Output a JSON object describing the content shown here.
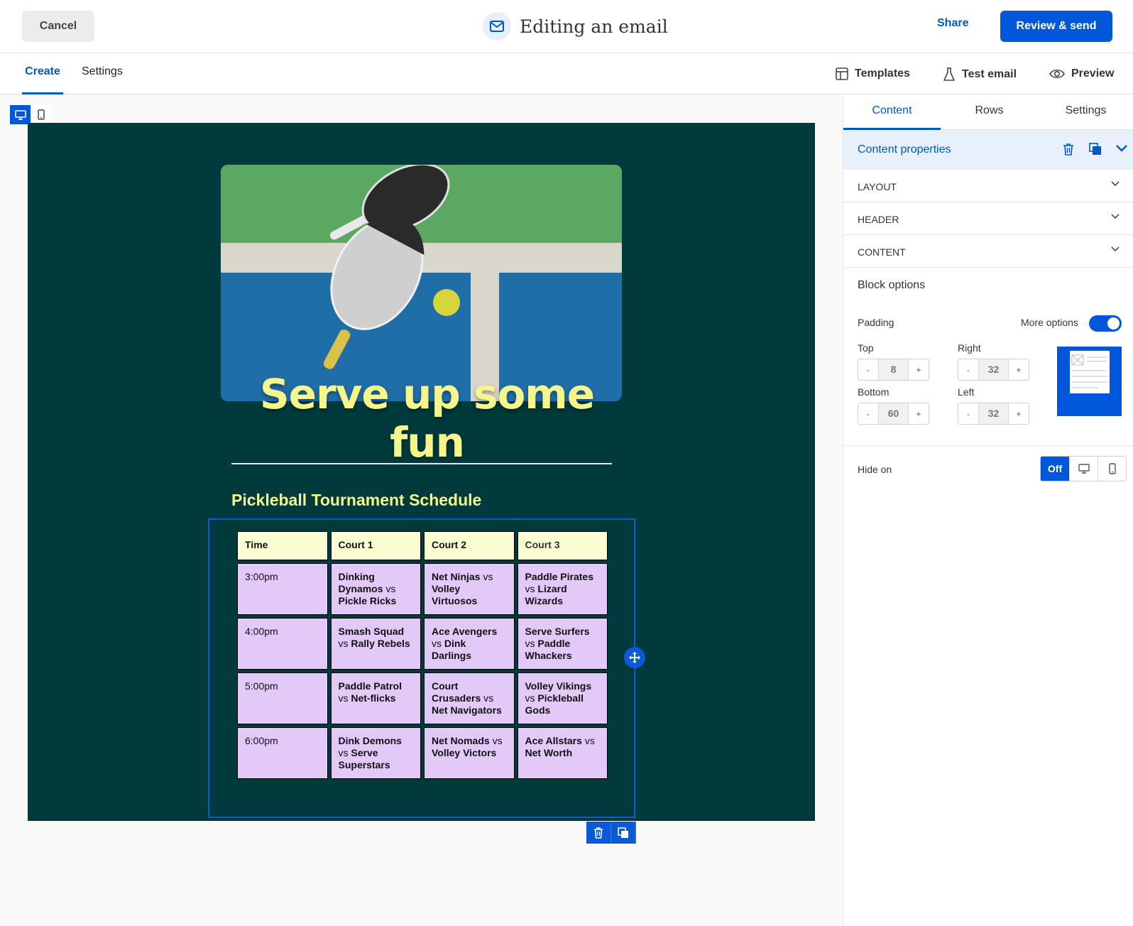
{
  "topbar": {
    "cancel_label": "Cancel",
    "title": "Editing an email",
    "share_label": "Share",
    "send_label": "Review & send"
  },
  "subbar": {
    "tabs": [
      {
        "label": "Create",
        "active": true
      },
      {
        "label": "Settings",
        "active": false
      }
    ],
    "templates_label": "Templates",
    "test_email_label": "Test email",
    "preview_label": "Preview"
  },
  "email": {
    "headline": "Serve up some fun",
    "schedule_title": "Pickleball Tournament Schedule",
    "table": {
      "headers": [
        "Time",
        "Court 1",
        "Court 2",
        "Court 3"
      ],
      "rows": [
        {
          "time": "3:00pm",
          "court1": [
            "Dinking Dynamos",
            "Pickle Ricks"
          ],
          "court2": [
            "Net Ninjas",
            "Volley Virtuosos"
          ],
          "court3": [
            "Paddle Pirates",
            "Lizard Wizards"
          ]
        },
        {
          "time": "4:00pm",
          "court1": [
            "Smash Squad",
            "Rally Rebels"
          ],
          "court2": [
            "Ace Avengers",
            "Dink Darlings"
          ],
          "court3": [
            "Serve Surfers",
            "Paddle Whackers"
          ]
        },
        {
          "time": "5:00pm",
          "court1": [
            "Paddle Patrol",
            "Net-flicks"
          ],
          "court2": [
            "Court Crusaders",
            "Net Navigators"
          ],
          "court3": [
            "Volley Vikings",
            "Pickleball Gods"
          ]
        },
        {
          "time": "6:00pm",
          "court1": [
            "Dink Demons",
            "Serve Superstars"
          ],
          "court2": [
            "Net Nomads",
            "Volley Victors"
          ],
          "court3": [
            "Ace Allstars",
            "Net Worth"
          ]
        }
      ],
      "vs_label": "vs"
    }
  },
  "panel": {
    "tabs": [
      "Content",
      "Rows",
      "Settings"
    ],
    "active_tab": "Content",
    "content_properties_label": "Content properties",
    "sections": [
      "LAYOUT",
      "HEADER",
      "CONTENT"
    ],
    "block_options_label": "Block options",
    "padding_label": "Padding",
    "more_options_label": "More options",
    "more_options_on": true,
    "padding": {
      "top": {
        "label": "Top",
        "value": "8"
      },
      "right": {
        "label": "Right",
        "value": "32"
      },
      "bottom": {
        "label": "Bottom",
        "value": "60"
      },
      "left": {
        "label": "Left",
        "value": "32"
      }
    },
    "stepper_minus": "-",
    "stepper_plus": "+",
    "hide_on_label": "Hide on",
    "hide_on_off_label": "Off"
  },
  "colors": {
    "accent": "#0057d9",
    "email_background": "#003a3c",
    "headline_yellow": "#f6f58c",
    "table_header": "#fbfcd2",
    "table_cell": "#e2c9f7"
  }
}
